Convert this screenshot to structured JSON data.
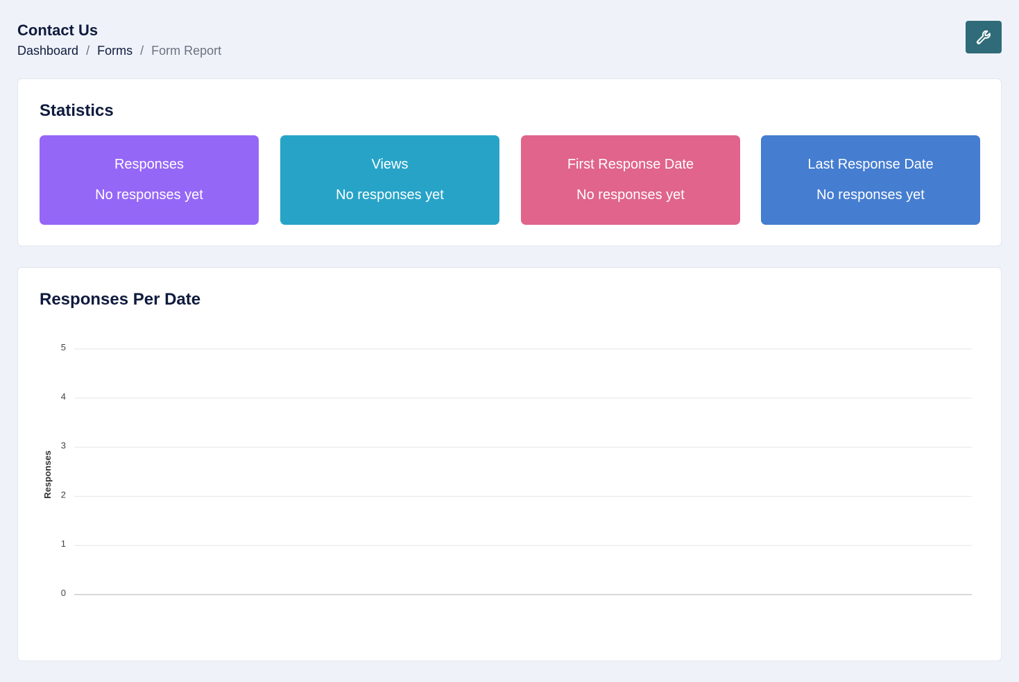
{
  "header": {
    "title": "Contact Us",
    "breadcrumb": [
      {
        "label": "Dashboard"
      },
      {
        "label": "Forms"
      },
      {
        "label": "Form Report"
      }
    ],
    "separator": "/",
    "tool_button_icon": "wrench-icon",
    "tool_button_color": "#2f6b78"
  },
  "statistics": {
    "title": "Statistics",
    "tiles": [
      {
        "label": "Responses",
        "value": "No responses yet",
        "color": "#9567f7"
      },
      {
        "label": "Views",
        "value": "No responses yet",
        "color": "#27a3c8"
      },
      {
        "label": "First Response Date",
        "value": "No responses yet",
        "color": "#e0648b"
      },
      {
        "label": "Last Response Date",
        "value": "No responses yet",
        "color": "#457dd0"
      }
    ]
  },
  "chart": {
    "title": "Responses Per Date"
  },
  "chart_data": {
    "type": "line",
    "title": "Responses Per Date",
    "xlabel": "",
    "ylabel": "Responses",
    "ylim": [
      0,
      5
    ],
    "yticks": [
      "5",
      "4",
      "3",
      "2",
      "1",
      "0"
    ],
    "x": [],
    "series": [],
    "grid": true
  }
}
